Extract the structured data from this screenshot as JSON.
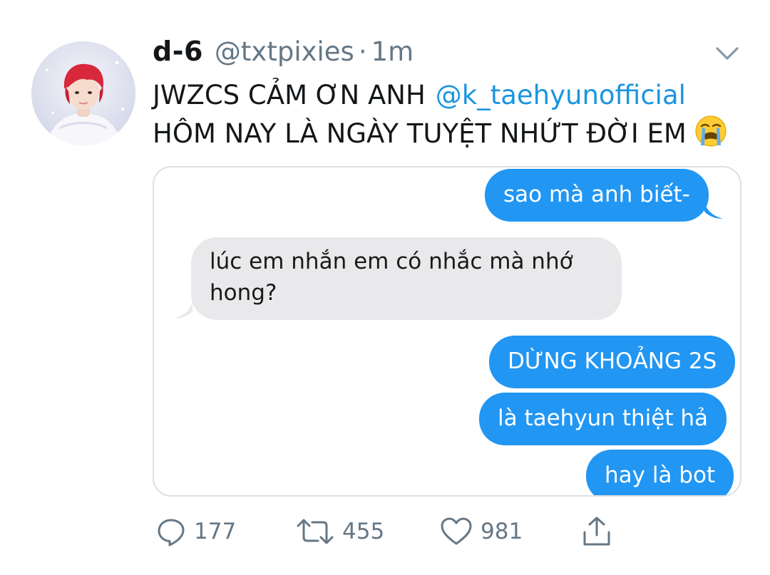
{
  "tweet": {
    "display_name": "d-6",
    "handle": "@txtpixies",
    "separator": "·",
    "time": "1m",
    "text_line1": "JWZCS CẢM ƠN ANH",
    "mention": "@k_taehyunofficial",
    "text_line2": "HÔM NAY LÀ NGÀY TUYỆT NHỨT ĐỜI EM",
    "emoji": "loudly-crying-face-emoji"
  },
  "chat": {
    "messages": [
      {
        "side": "sent",
        "lines": [
          "sao mà anh biết-"
        ]
      },
      {
        "side": "received",
        "lines": [
          "lúc em nhắn em có nhắc mà nhớ",
          "hong?"
        ]
      },
      {
        "side": "sent",
        "lines": [
          "DỪNG KHOẢNG 2S"
        ]
      },
      {
        "side": "sent",
        "lines": [
          "là taehyun thiệt hả"
        ]
      },
      {
        "side": "sent",
        "lines": [
          "hay là bot"
        ]
      }
    ]
  },
  "actions": {
    "reply": {
      "icon": "reply-icon",
      "count": "177"
    },
    "retweet": {
      "icon": "retweet-icon",
      "count": "455"
    },
    "like": {
      "icon": "heart-icon",
      "count": "981"
    },
    "share": {
      "icon": "share-icon"
    }
  },
  "colors": {
    "text": "#14171a",
    "secondary": "#657786",
    "link": "#1b95e0",
    "sent_bubble": "#2196f3",
    "received_bubble": "#e9e9eb"
  }
}
